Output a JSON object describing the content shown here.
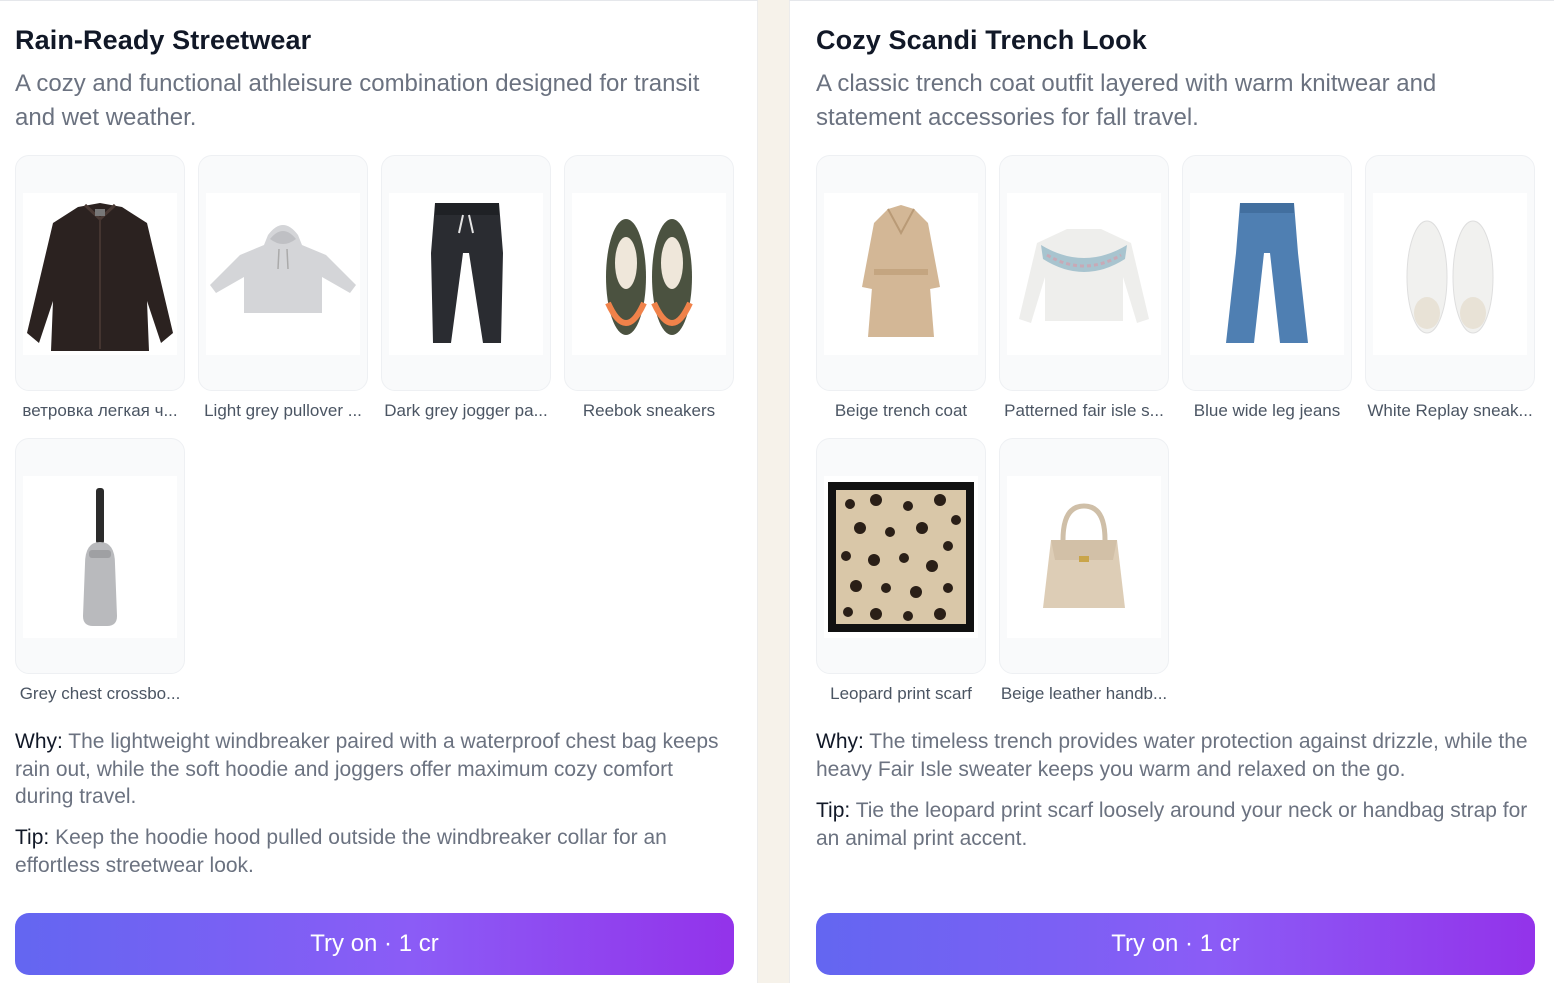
{
  "outfits": [
    {
      "title": "Rain-Ready Streetwear",
      "description": "A cozy and functional athleisure combination designed for transit and wet weather.",
      "items": [
        {
          "label": "ветровка легкая ч...",
          "icon": "black-windbreaker-jacket-image"
        },
        {
          "label": "Light grey pullover ...",
          "icon": "grey-hoodie-image"
        },
        {
          "label": "Dark grey jogger pa...",
          "icon": "dark-jogger-pants-image"
        },
        {
          "label": "Reebok sneakers",
          "icon": "reebok-sneakers-image"
        },
        {
          "label": "Grey chest crossbo...",
          "icon": "grey-chest-bag-image"
        }
      ],
      "why_label": "Why:",
      "why_text": " The lightweight windbreaker paired with a waterproof chest bag keeps rain out, while the soft hoodie and joggers offer maximum cozy comfort during travel.",
      "tip_label": "Tip:",
      "tip_text": " Keep the hoodie hood pulled outside the windbreaker collar for an effortless streetwear look.",
      "button_label": "Try on · 1 cr"
    },
    {
      "title": "Cozy Scandi Trench Look",
      "description": "A classic trench coat outfit layered with warm knitwear and statement accessories for fall travel.",
      "items": [
        {
          "label": "Beige trench coat",
          "icon": "beige-trench-coat-image"
        },
        {
          "label": "Patterned fair isle s...",
          "icon": "fair-isle-sweater-image"
        },
        {
          "label": "Blue wide leg jeans",
          "icon": "blue-jeans-image"
        },
        {
          "label": "White Replay sneak...",
          "icon": "white-sneakers-image"
        },
        {
          "label": "Leopard print scarf",
          "icon": "leopard-scarf-image"
        },
        {
          "label": "Beige leather handb...",
          "icon": "beige-handbag-image"
        }
      ],
      "why_label": "Why:",
      "why_text": " The timeless trench provides water protection against drizzle, while the heavy Fair Isle sweater keeps you warm and relaxed on the go.",
      "tip_label": "Tip:",
      "tip_text": " Tie the leopard print scarf loosely around your neck or handbag strap for an animal print accent.",
      "button_label": "Try on · 1 cr"
    }
  ],
  "colors": {
    "button_gradient_start": "#6366f1",
    "button_gradient_end": "#9333ea",
    "title": "#111827",
    "muted_text": "#6b7280"
  }
}
